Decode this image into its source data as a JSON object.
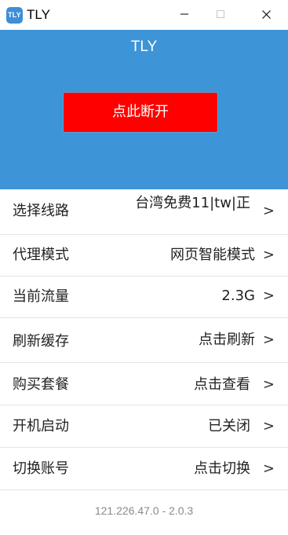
{
  "window": {
    "icon_text": "TLY",
    "title": "TLY"
  },
  "header": {
    "title": "TLY",
    "connect_button_label": "点此断开",
    "connect_button_color": "#ff0000",
    "background_color": "#3d94d6"
  },
  "settings": {
    "route": {
      "label": "选择线路",
      "value": "台湾免费11|tw|正",
      "arrow": ">"
    },
    "proxy_mode": {
      "label": "代理模式",
      "value": "网页智能模式",
      "arrow": ">"
    },
    "traffic": {
      "label": "当前流量",
      "value": "2.3G",
      "arrow": ">"
    },
    "cache": {
      "label": "刷新缓存",
      "value": "点击刷新",
      "arrow": ">"
    },
    "purchase": {
      "label": "购买套餐",
      "value": "点击查看",
      "arrow": ">"
    },
    "autostart": {
      "label": "开机启动",
      "value": "已关闭",
      "arrow": ">"
    },
    "account": {
      "label": "切换账号",
      "value": "点击切换",
      "arrow": ">"
    }
  },
  "footer": {
    "version_text": "121.226.47.0 - 2.0.3"
  }
}
